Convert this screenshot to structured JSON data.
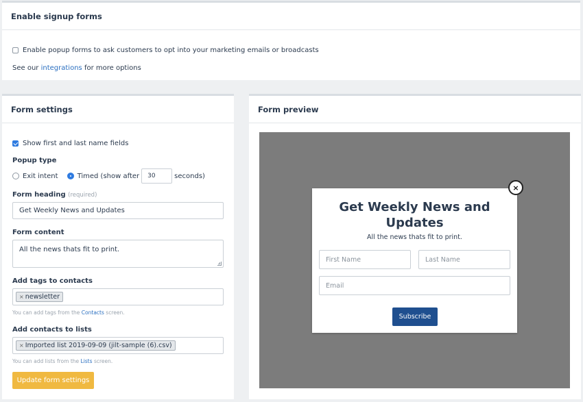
{
  "signup": {
    "title": "Enable signup forms",
    "enable_popup_label": "Enable popup forms to ask customers to opt into your marketing emails or broadcasts",
    "enable_popup_checked": false,
    "see_our": "See our",
    "integrations_link": "integrations",
    "more_options": "for more options"
  },
  "settings": {
    "title": "Form settings",
    "show_names_label": "Show first and last name fields",
    "show_names_checked": true,
    "popup_type_label": "Popup type",
    "exit_intent_label": "Exit intent",
    "timed_label": "Timed (show after",
    "timed_seconds": "30",
    "seconds_label": "seconds)",
    "selected_popup_type": "Timed",
    "form_heading_label": "Form heading",
    "required_label": "(required)",
    "form_heading_value": "Get Weekly News and Updates",
    "form_content_label": "Form content",
    "form_content_value": "All the news thats fit to print.",
    "tags_label": "Add tags to contacts",
    "tags": [
      "newsletter"
    ],
    "tags_hint_pre": "You can add tags from the",
    "tags_hint_link": "Contacts",
    "tags_hint_post": "screen.",
    "lists_label": "Add contacts to lists",
    "lists": [
      "Imported list 2019-09-09 (jilt-sample (6).csv)"
    ],
    "lists_hint_pre": "You can add lists from the",
    "lists_hint_link": "Lists",
    "lists_hint_post": "screen.",
    "update_button": "Update form settings"
  },
  "preview": {
    "title": "Form preview",
    "close_symbol": "×",
    "modal_heading": "Get Weekly News and Updates",
    "modal_content": "All the news thats fit to print.",
    "first_name_placeholder": "First Name",
    "last_name_placeholder": "Last Name",
    "email_placeholder": "Email",
    "subscribe_button": "Subscribe"
  },
  "colors": {
    "accent": "#f0b941",
    "link": "#2a6fc0",
    "subscribe": "#1f4f8f",
    "check": "#2f7be0"
  }
}
